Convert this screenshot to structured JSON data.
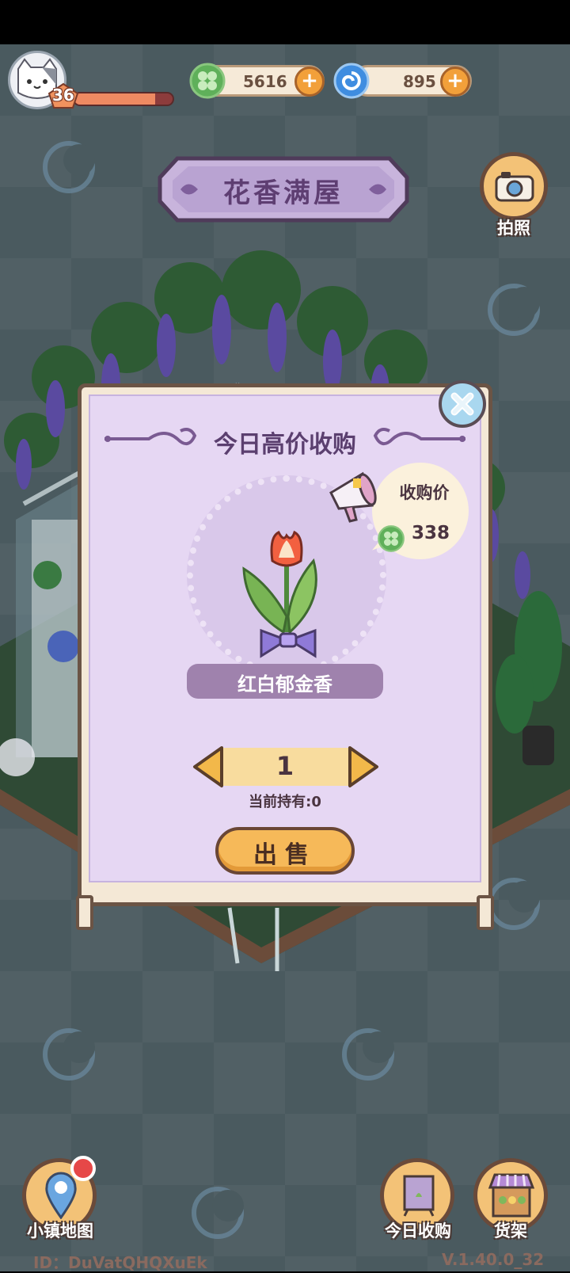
{
  "header": {
    "level": "36",
    "level_progress": 0.82,
    "clover_amount": "5616",
    "gem_amount": "895"
  },
  "shop_title": "花香满屋",
  "side_buttons": {
    "photo_label": "拍照",
    "town_map_label": "小镇地图",
    "today_buy_label": "今日收购",
    "shelf_label": "货架"
  },
  "dialog": {
    "title": "今日高价收购",
    "price_label": "收购价",
    "price_value": "338",
    "item_name": "红白郁金香",
    "quantity": "1",
    "held_text": "当前持有:0",
    "sell_label": "出售"
  },
  "footer": {
    "id_text": "ID：DuVatQHQXuEk",
    "version_text": "V.1.40.0_32"
  },
  "colors": {
    "background": "#4a5a5f",
    "panel": "#e6d7f3",
    "accent_orange": "#f6b959",
    "clover_green": "#5fb05a"
  }
}
